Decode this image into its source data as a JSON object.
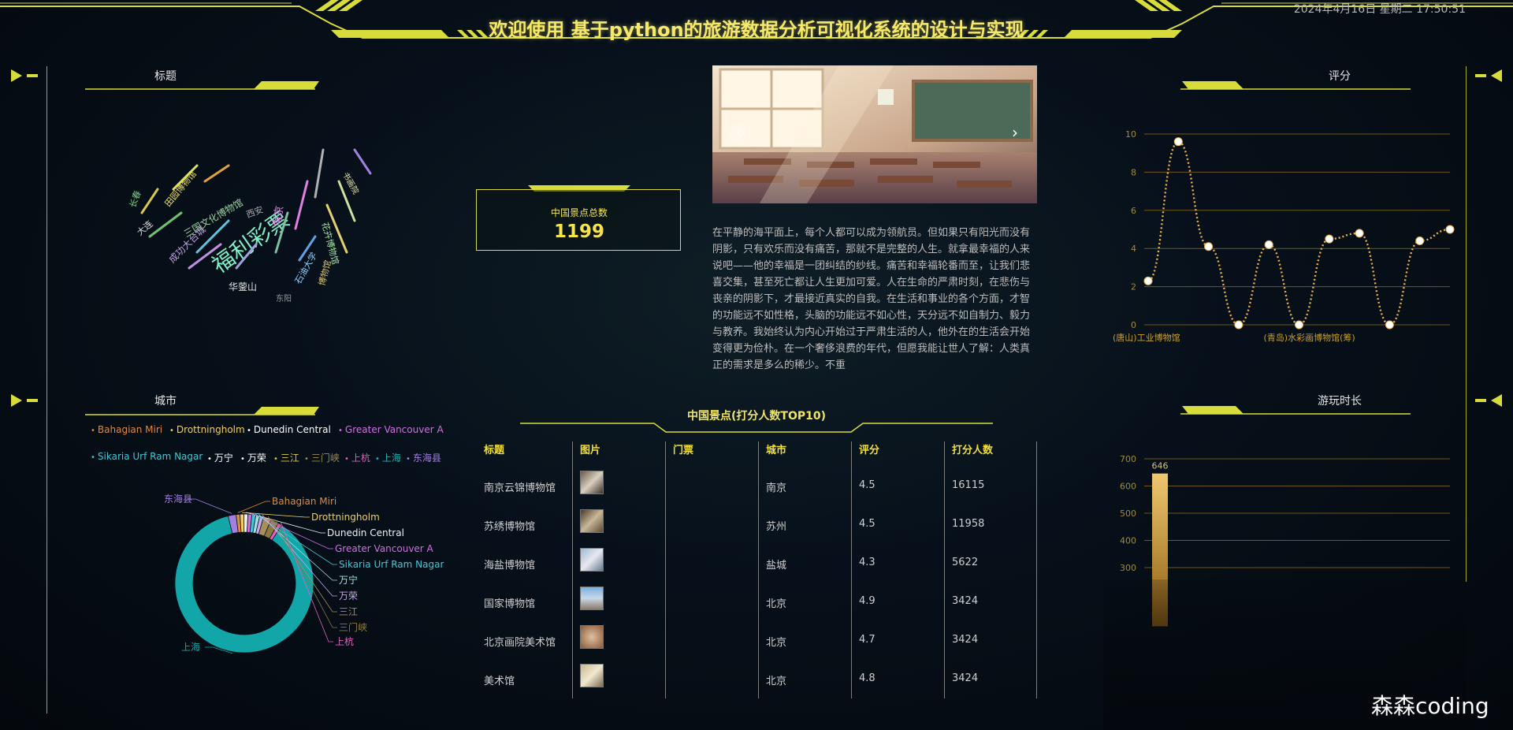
{
  "header": {
    "title": "欢迎使用 基于python的旅游数据分析可视化系统的设计与实现",
    "datetime": "2024年4月16日 星期二 17:50:51"
  },
  "panels": {
    "wordcloud_title": "标题",
    "city_title": "城市",
    "score_title": "评分",
    "duration_title": "游玩时长"
  },
  "wordcloud": {
    "words": [
      {
        "text": "福利彩票",
        "color": "#7ff0c8"
      },
      {
        "text": "华蓥山",
        "color": "#e6e6e6"
      },
      {
        "text": "东阳",
        "color": "#999999"
      },
      {
        "text": "石油大学",
        "color": "#8fd0ff"
      },
      {
        "text": "博物馆",
        "color": "#d9c36a"
      },
      {
        "text": "三国文化博物馆",
        "color": "#9ad0a0"
      },
      {
        "text": "成功大台城",
        "color": "#c0a0e0"
      },
      {
        "text": "田园博物馆",
        "color": "#f0e060"
      },
      {
        "text": "南京",
        "color": "#e080e0"
      },
      {
        "text": "西安",
        "color": "#aaaaaa"
      },
      {
        "text": "书画院",
        "color": "#e0e0a0"
      },
      {
        "text": "花卉博物馆",
        "color": "#a0e0a0"
      },
      {
        "text": "大连",
        "color": "#e0e0e0"
      },
      {
        "text": "长春",
        "color": "#80d080"
      }
    ]
  },
  "stat": {
    "label": "中国景点总数",
    "value": "1199"
  },
  "carousel": {
    "prev_glyph": "‹",
    "next_glyph": "›"
  },
  "description": "在平静的海平面上，每个人都可以成为领航员。但如果只有阳光而没有阴影，只有欢乐而没有痛苦，那就不是完整的人生。就拿最幸福的人来说吧——他的幸福是一团纠结的纱线。痛苦和幸福轮番而至，让我们悲喜交集，甚至死亡都让人生更加可爱。人在生命的严肃时刻，在悲伤与丧亲的阴影下，才最接近真实的自我。在生活和事业的各个方面，才智的功能远不如性格，头脑的功能远不如心性，天分远不如自制力、毅力与教养。我始终认为内心开始过于严肃生活的人，他外在的生活会开始变得更为俭朴。在一个奢侈浪费的年代，但愿我能让世人了解：人类真正的需求是多么的稀少。不重",
  "table": {
    "title": "中国景点(打分人数TOP10)",
    "headers": [
      "标题",
      "图片",
      "门票",
      "城市",
      "评分",
      "打分人数"
    ],
    "rows": [
      {
        "title": "南京云锦博物馆",
        "ticket": "",
        "city": "南京",
        "score": "4.5",
        "count": "16115"
      },
      {
        "title": "苏绣博物馆",
        "ticket": "",
        "city": "苏州",
        "score": "4.5",
        "count": "11958"
      },
      {
        "title": "海盐博物馆",
        "ticket": "",
        "city": "盐城",
        "score": "4.3",
        "count": "5622"
      },
      {
        "title": "国家博物馆",
        "ticket": "",
        "city": "北京",
        "score": "4.9",
        "count": "3424"
      },
      {
        "title": "北京画院美术馆",
        "ticket": "",
        "city": "北京",
        "score": "4.7",
        "count": "3424"
      },
      {
        "title": "美术馆",
        "ticket": "",
        "city": "北京",
        "score": "4.8",
        "count": "3424"
      }
    ]
  },
  "city_legend": [
    {
      "name": "Bahagian Miri",
      "color": "#e08a3c"
    },
    {
      "name": "Drottningholm",
      "color": "#f0d060"
    },
    {
      "name": "Dunedin Central",
      "color": "#ffffff"
    },
    {
      "name": "Greater Vancouver A",
      "color": "#d070e0"
    },
    {
      "name": "Sikaria Urf Ram Nagar",
      "color": "#40c8d8"
    },
    {
      "name": "万宁",
      "color": "#ffffff"
    },
    {
      "name": "万荣",
      "color": "#ffffff"
    },
    {
      "name": "三江",
      "color": "#d8c850"
    },
    {
      "name": "三门峡",
      "color": "#9a8a50"
    },
    {
      "name": "上杭",
      "color": "#e060c0"
    },
    {
      "name": "上海",
      "color": "#1ab0b0"
    },
    {
      "name": "东海县",
      "color": "#a080e0"
    }
  ],
  "chart_data": [
    {
      "type": "pie",
      "title": "城市",
      "variant": "donut",
      "categories": [
        "Bahagian Miri",
        "Drottningholm",
        "Dunedin Central",
        "Greater Vancouver A",
        "Sikaria Urf Ram Nagar",
        "万宁",
        "万荣",
        "三江",
        "三门峡",
        "上杭",
        "上海",
        "东海县"
      ],
      "values": [
        1,
        1,
        1,
        1,
        1,
        1,
        1,
        2,
        2,
        1,
        95,
        2
      ],
      "colors": [
        "#e08a3c",
        "#f0d060",
        "#f0f0f0",
        "#d070e0",
        "#40c8d8",
        "#a0e0e0",
        "#c8a8e8",
        "#a88e5a",
        "#8a7a40",
        "#e060c0",
        "#12a6a8",
        "#a080e0"
      ]
    },
    {
      "type": "line",
      "title": "评分",
      "x": [
        "(唐山)工业博物馆",
        "p2",
        "p3",
        "p4",
        "p5",
        "(青岛)水彩画博物馆(筹)",
        "p7",
        "p8",
        "p9",
        "p10",
        "p11"
      ],
      "x_tick_labels": [
        "(唐山)工业博物馆",
        "(青岛)水彩画博物馆(筹)"
      ],
      "values": [
        2.3,
        9.6,
        4.1,
        0,
        4.2,
        0,
        4.5,
        4.8,
        0,
        4.4,
        5.0
      ],
      "ylim": [
        0,
        10
      ],
      "yticks": [
        0,
        2,
        4,
        6,
        8,
        10
      ],
      "grid": true
    },
    {
      "type": "bar",
      "title": "游玩时长",
      "categories": [
        ""
      ],
      "values": [
        646
      ],
      "data_labels": [
        "646"
      ],
      "ylim": [
        200,
        700
      ],
      "yticks": [
        300,
        400,
        500,
        600,
        700
      ],
      "grid": true
    }
  ],
  "watermark": "森森coding"
}
